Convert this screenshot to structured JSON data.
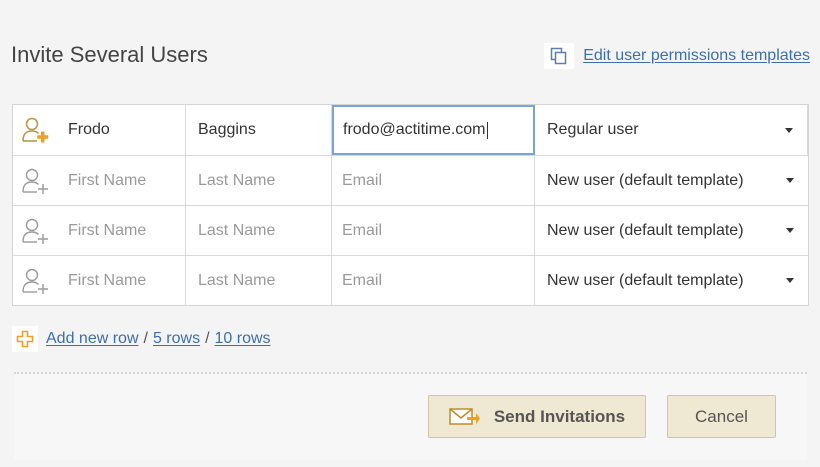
{
  "page": {
    "title": "Invite Several Users",
    "templates_link": "Edit user permissions templates"
  },
  "rows": [
    {
      "first_name": "Frodo",
      "last_name": "Baggins",
      "email": "frodo@actitime.com",
      "role": "Regular user",
      "active": true
    },
    {
      "first_name_placeholder": "First Name",
      "last_name_placeholder": "Last Name",
      "email_placeholder": "Email",
      "role": "New user (default template)"
    },
    {
      "first_name_placeholder": "First Name",
      "last_name_placeholder": "Last Name",
      "email_placeholder": "Email",
      "role": "New user (default template)"
    },
    {
      "first_name_placeholder": "First Name",
      "last_name_placeholder": "Last Name",
      "email_placeholder": "Email",
      "role": "New user (default template)"
    }
  ],
  "add_rows": {
    "add_new_row": "Add new row",
    "separator": "/",
    "five_rows": "5 rows",
    "ten_rows": "10 rows"
  },
  "footer": {
    "send_label": "Send Invitations",
    "cancel_label": "Cancel"
  },
  "icons": {
    "copy": "copy-pages-icon",
    "user_add": "user-add-icon",
    "plus": "plus-icon",
    "mail": "mail-send-icon",
    "dropdown": "chevron-down-icon"
  },
  "colors": {
    "link": "#3e6fa8",
    "accent_orange": "#f0a020",
    "button_bg": "#efe8d3",
    "active_border": "#7aa3d6"
  }
}
